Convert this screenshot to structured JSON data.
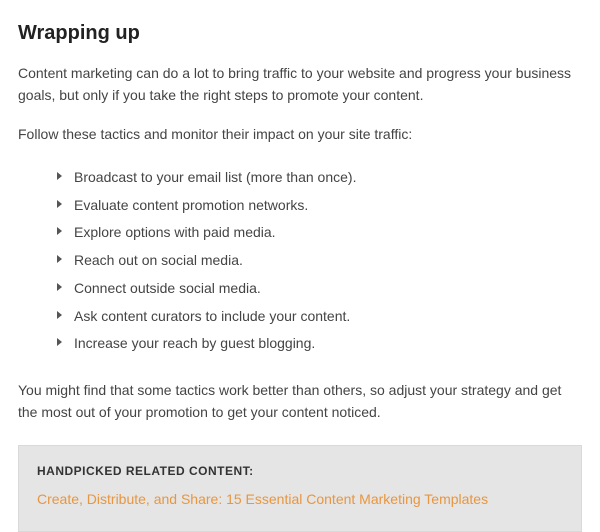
{
  "heading": "Wrapping up",
  "para1": "Content marketing can do a lot to bring traffic to your website and progress your business goals, but only if you take the right steps to promote your content.",
  "para2": "Follow these tactics and monitor their impact on your site traffic:",
  "bullets": [
    "Broadcast to your email list (more than once).",
    "Evaluate content promotion networks.",
    "Explore options with paid media.",
    "Reach out on social media.",
    "Connect outside social media.",
    "Ask content curators to include your content.",
    "Increase your reach by guest blogging."
  ],
  "para3": "You might find that some tactics work better than others, so adjust your strategy and get the most out of your promotion to get your content noticed.",
  "related": {
    "title": "HANDPICKED RELATED CONTENT:",
    "link_text": "Create, Distribute, and Share: 15 Essential Content Marketing Templates"
  }
}
